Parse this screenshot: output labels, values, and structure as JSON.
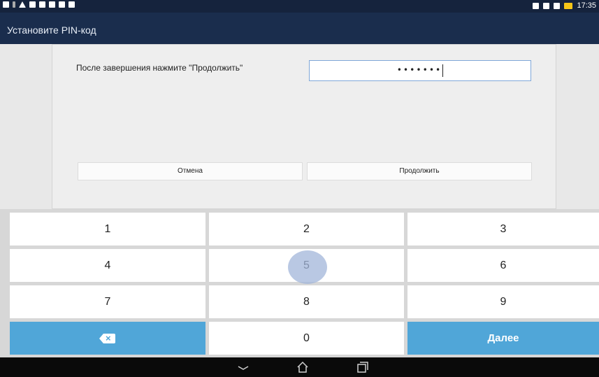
{
  "status_bar": {
    "time": "17:35"
  },
  "app_bar": {
    "title": "Установите PIN-код"
  },
  "dialog": {
    "prompt": "После завершения нажмите \"Продолжить\"",
    "pin_masked": "•••••••",
    "cancel_label": "Отмена",
    "continue_label": "Продолжить"
  },
  "keypad": {
    "keys": [
      "1",
      "2",
      "3",
      "4",
      "5",
      "6",
      "7",
      "8",
      "9",
      "0"
    ],
    "next_label": "Далее"
  },
  "colors": {
    "statusbar": "#15233d",
    "appbar": "#1a2d4d",
    "accent": "#50a6d8",
    "touch_highlight": "#a2b6da"
  },
  "icons": {
    "backspace": "backspace-icon",
    "nav_back": "back-icon",
    "nav_home": "home-icon",
    "nav_recent": "recent-apps-icon"
  }
}
